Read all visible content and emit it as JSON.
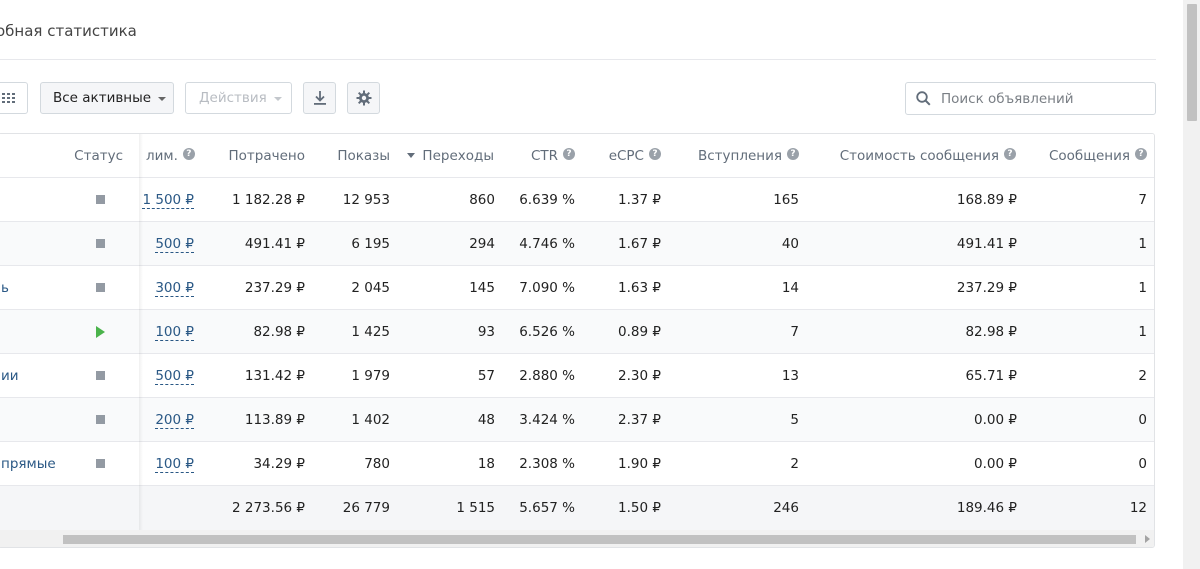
{
  "page": {
    "title": "обная статистика"
  },
  "toolbar": {
    "filter_label": "Все активные",
    "actions_label": "Действия",
    "search_placeholder": "Поиск объявлений"
  },
  "table": {
    "headers": {
      "status": "Статус",
      "limit": "лим.",
      "spent": "Потрачено",
      "impressions": "Показы",
      "clicks": "Переходы",
      "ctr": "CTR",
      "ecpc": "eCPC",
      "joins": "Вступления",
      "msg_cost": "Стоимость сообщения",
      "messages": "Сообщения"
    },
    "rows": [
      {
        "name": "",
        "status": "stopped",
        "limit": "1 500 ₽",
        "spent": "1 182.28 ₽",
        "impressions": "12 953",
        "clicks": "860",
        "ctr": "6.639 %",
        "ecpc": "1.37 ₽",
        "joins": "165",
        "msg_cost": "168.89 ₽",
        "messages": "7"
      },
      {
        "name": "",
        "status": "stopped",
        "limit": "500 ₽",
        "spent": "491.41 ₽",
        "impressions": "6 195",
        "clicks": "294",
        "ctr": "4.746 %",
        "ecpc": "1.67 ₽",
        "joins": "40",
        "msg_cost": "491.41 ₽",
        "messages": "1"
      },
      {
        "name": "ь",
        "status": "stopped",
        "limit": "300 ₽",
        "spent": "237.29 ₽",
        "impressions": "2 045",
        "clicks": "145",
        "ctr": "7.090 %",
        "ecpc": "1.63 ₽",
        "joins": "14",
        "msg_cost": "237.29 ₽",
        "messages": "1"
      },
      {
        "name": "",
        "status": "running",
        "limit": "100 ₽",
        "spent": "82.98 ₽",
        "impressions": "1 425",
        "clicks": "93",
        "ctr": "6.526 %",
        "ecpc": "0.89 ₽",
        "joins": "7",
        "msg_cost": "82.98 ₽",
        "messages": "1"
      },
      {
        "name": "ии",
        "status": "stopped",
        "limit": "500 ₽",
        "spent": "131.42 ₽",
        "impressions": "1 979",
        "clicks": "57",
        "ctr": "2.880 %",
        "ecpc": "2.30 ₽",
        "joins": "13",
        "msg_cost": "65.71 ₽",
        "messages": "2"
      },
      {
        "name": "",
        "status": "stopped",
        "limit": "200 ₽",
        "spent": "113.89 ₽",
        "impressions": "1 402",
        "clicks": "48",
        "ctr": "3.424 %",
        "ecpc": "2.37 ₽",
        "joins": "5",
        "msg_cost": "0.00 ₽",
        "messages": "0"
      },
      {
        "name": "прямые",
        "status": "stopped",
        "limit": "100 ₽",
        "spent": "34.29 ₽",
        "impressions": "780",
        "clicks": "18",
        "ctr": "2.308 %",
        "ecpc": "1.90 ₽",
        "joins": "2",
        "msg_cost": "0.00 ₽",
        "messages": "0"
      }
    ],
    "totals": {
      "spent": "2 273.56 ₽",
      "impressions": "26 779",
      "clicks": "1 515",
      "ctr": "5.657 %",
      "ecpc": "1.50 ₽",
      "joins": "246",
      "msg_cost": "189.46 ₽",
      "messages": "12"
    }
  },
  "colors": {
    "link": "#2a5885",
    "running": "#4bb34b",
    "stopped": "#939aa3"
  }
}
